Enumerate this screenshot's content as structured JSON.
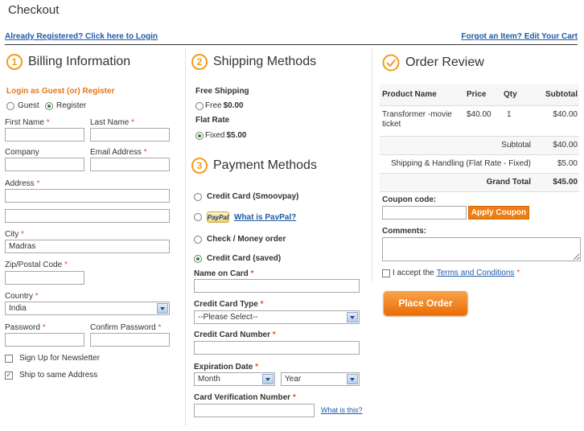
{
  "header": {
    "title": "Checkout",
    "login_link": "Already Registered? Click here to Login",
    "cart_link": "Forgot an Item? Edit Your Cart"
  },
  "billing": {
    "step": "1",
    "title": "Billing Information",
    "guest_register_label": "Login as Guest (or) Register",
    "guest_option": "Guest",
    "register_option": "Register",
    "first_name_label": "First Name",
    "last_name_label": "Last Name",
    "company_label": "Company",
    "email_label": "Email Address",
    "address_label": "Address",
    "city_label": "City",
    "city_value": "Madras",
    "zip_label": "Zip/Postal Code",
    "country_label": "Country",
    "country_value": "India",
    "password_label": "Password",
    "confirm_password_label": "Confirm Password",
    "newsletter_label": "Sign Up for Newsletter",
    "ship_same_label": "Ship to same Address",
    "required_mark": "*"
  },
  "shipping": {
    "step": "2",
    "title": "Shipping Methods",
    "free_heading": "Free Shipping",
    "free_option": "Free",
    "free_price": "$0.00",
    "flat_heading": "Flat Rate",
    "fixed_option": "Fixed",
    "fixed_price": "$5.00"
  },
  "payment": {
    "step": "3",
    "title": "Payment Methods",
    "cc_smoovpay": "Credit Card (Smoovpay)",
    "paypal_badge": "PayPal",
    "paypal_link": "What is PayPal?",
    "check_money": "Check / Money order",
    "cc_saved": "Credit Card (saved)",
    "name_on_card_label": "Name on Card",
    "cc_type_label": "Credit Card Type",
    "cc_type_value": "--Please Select--",
    "cc_number_label": "Credit Card Number",
    "exp_label": "Expiration Date",
    "month_value": "Month",
    "year_value": "Year",
    "cvv_label": "Card Verification Number",
    "cvv_link": "What is this?"
  },
  "review": {
    "title": "Order Review",
    "headers": [
      "Product Name",
      "Price",
      "Qty",
      "Subtotal"
    ],
    "item": {
      "name": "Transformer -movie ticket",
      "price": "$40.00",
      "qty": "1",
      "subtotal": "$40.00"
    },
    "subtotal_label": "Subtotal",
    "subtotal_value": "$40.00",
    "shipping_label": "Shipping & Handling (Flat Rate - Fixed)",
    "shipping_value": "$5.00",
    "grand_label": "Grand Total",
    "grand_value": "$45.00",
    "coupon_label": "Coupon code:",
    "coupon_button": "Apply Coupon",
    "comments_label": "Comments:",
    "terms_prefix": "I accept the",
    "terms_link": "Terms and Conditions",
    "place_order": "Place Order"
  },
  "colors": {
    "accent": "#f39c1c",
    "link": "#1f5aa6",
    "button": "#ef7d12"
  }
}
